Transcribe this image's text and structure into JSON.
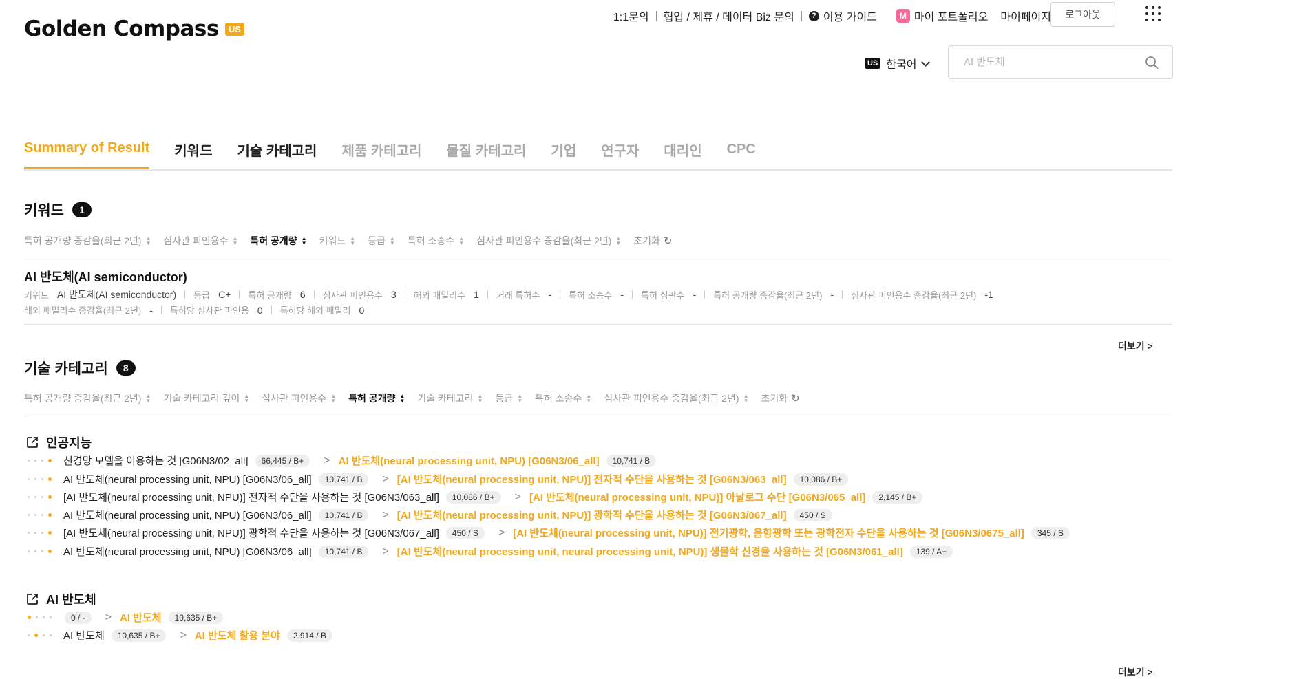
{
  "header": {
    "logo": "Golden Compass",
    "region_badge": "US",
    "links": [
      "1:1문의",
      "협업 / 제휴 / 데이터 Biz 문의",
      "이용 가이드"
    ],
    "portfolio": "마이 포트폴리오",
    "portfolio_icon_letter": "M",
    "mypage": "마이페이지",
    "logout": "로그아웃",
    "lang_badge": "US",
    "lang": "한국어",
    "search_placeholder": "AI 반도체"
  },
  "tabs": [
    "Summary of Result",
    "키워드",
    "기술 카테고리",
    "제품 카테고리",
    "물질 카테고리",
    "기업",
    "연구자",
    "대리인",
    "CPC"
  ],
  "keyword_section": {
    "title": "키워드",
    "count": "1",
    "filters": [
      "특허 공개량 증감율(최근 2년)",
      "심사관 피인용수",
      "특허 공개량",
      "키워드",
      "등급",
      "특허 소송수",
      "심사관 피인용수 증감율(최근 2년)",
      "초기화"
    ],
    "item": {
      "title": "AI 반도체(AI semiconductor)",
      "line1": [
        {
          "label": "키워드",
          "value": "AI 반도체(AI semiconductor)"
        },
        {
          "label": "등급",
          "value": "C+"
        },
        {
          "label": "특허 공개량",
          "value": "6"
        },
        {
          "label": "심사관 피인용수",
          "value": "3"
        },
        {
          "label": "해외 패밀리수",
          "value": "1"
        },
        {
          "label": "거래 특허수",
          "value": "-"
        },
        {
          "label": "특허 소송수",
          "value": "-"
        },
        {
          "label": "특허 심판수",
          "value": "-"
        },
        {
          "label": "특허 공개량 증감율(최근 2년)",
          "value": "-"
        },
        {
          "label": "심사관 피인용수 증감율(최근 2년)",
          "value": "-1"
        }
      ],
      "line2": [
        {
          "label": "해외 패밀리수 증감율(최근 2년)",
          "value": "-"
        },
        {
          "label": "특허당 심사관 피인용",
          "value": "0"
        },
        {
          "label": "특허당 해외 패밀리",
          "value": "0"
        }
      ]
    },
    "more": "더보기 >"
  },
  "tech_section": {
    "title": "기술 카테고리",
    "count": "8",
    "filters": [
      "특허 공개량 증감율(최근 2년)",
      "기술 카테고리 깊이",
      "심사관 피인용수",
      "특허 공개량",
      "기술 카테고리",
      "등급",
      "특허 소송수",
      "심사관 피인용수 증감율(최근 2년)",
      "초기화"
    ],
    "groups": [
      {
        "name": "인공지능",
        "rows": [
          {
            "active_dot": 4,
            "from": "신경망 모델을 이용하는 것 [G06N3/02_all]",
            "from_chip": "66,445 / B+",
            "to": "AI 반도체(neural processing unit, NPU) [G06N3/06_all]",
            "to_chip": "10,741 / B"
          },
          {
            "active_dot": 4,
            "from": "AI 반도체(neural processing unit, NPU) [G06N3/06_all]",
            "from_chip": "10,741 / B",
            "to": "[AI 반도체(neural processing unit, NPU)] 전자적 수단을 사용하는 것 [G06N3/063_all]",
            "to_chip": "10,086 / B+"
          },
          {
            "active_dot": 4,
            "from": "[AI 반도체(neural processing unit, NPU)] 전자적 수단을 사용하는 것 [G06N3/063_all]",
            "from_chip": "10,086 / B+",
            "to": "[AI 반도체(neural processing unit, NPU)] 아날로그 수단 [G06N3/065_all]",
            "to_chip": "2,145 / B+"
          },
          {
            "active_dot": 4,
            "from": "AI 반도체(neural processing unit, NPU) [G06N3/06_all]",
            "from_chip": "10,741 / B",
            "to": "[AI 반도체(neural processing unit, NPU)] 광학적 수단을 사용하는 것 [G06N3/067_all]",
            "to_chip": "450 / S"
          },
          {
            "active_dot": 4,
            "from": "[AI 반도체(neural processing unit, NPU)] 광학적 수단을 사용하는 것 [G06N3/067_all]",
            "from_chip": "450 / S",
            "to": "[AI 반도체(neural processing unit, NPU)] 전기광학, 음향광학 또는 광학전자 수단을 사용하는 것 [G06N3/0675_all]",
            "to_chip": "345 / S"
          },
          {
            "active_dot": 4,
            "from": "AI 반도체(neural processing unit, NPU) [G06N3/06_all]",
            "from_chip": "10,741 / B",
            "to": "[AI 반도체(neural processing unit, neural processing unit, NPU)] 생물학 신경을 사용하는 것 [G06N3/061_all]",
            "to_chip": "139 / A+"
          }
        ]
      },
      {
        "name": "AI 반도체",
        "rows": [
          {
            "active_dot": 1,
            "from": "",
            "from_chip": "0 / -",
            "to": "AI 반도체",
            "to_chip": "10,635 / B+"
          },
          {
            "active_dot": 2,
            "from": "AI 반도체",
            "from_chip": "10,635 / B+",
            "to": "AI 반도체 활용 분야",
            "to_chip": "2,914 / B"
          }
        ]
      }
    ],
    "more": "더보기 >"
  }
}
